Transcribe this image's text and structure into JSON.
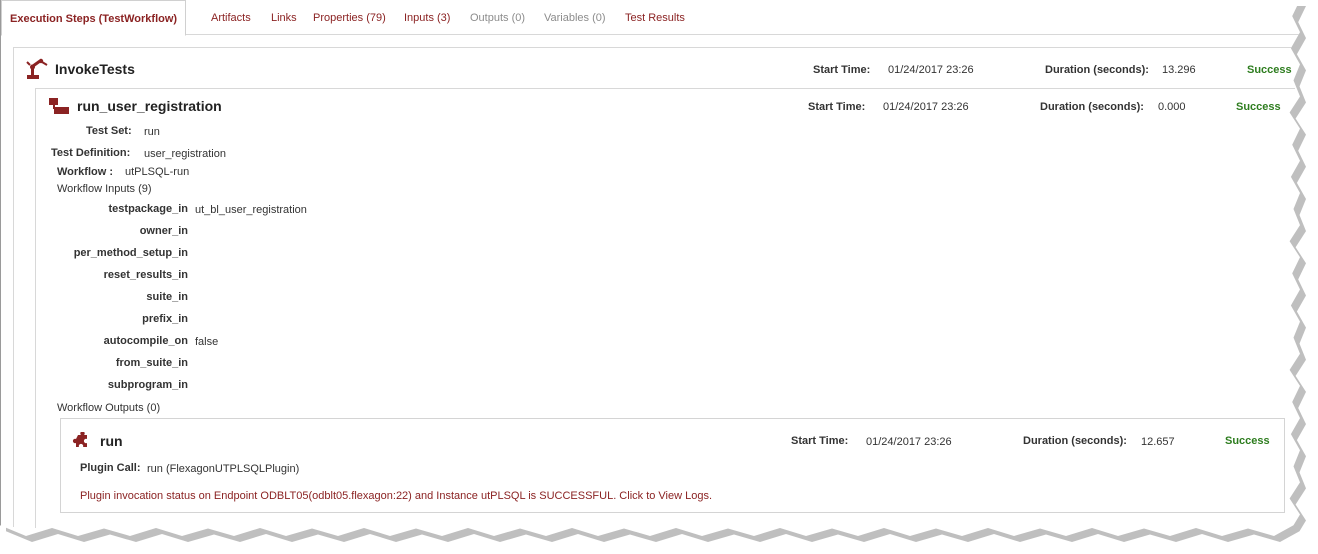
{
  "tabs": [
    {
      "label": "Execution Steps (TestWorkflow)",
      "state": "active"
    },
    {
      "label": "Artifacts",
      "state": "enabled"
    },
    {
      "label": "Links",
      "state": "enabled"
    },
    {
      "label": "Properties (79)",
      "state": "enabled"
    },
    {
      "label": "Inputs (3)",
      "state": "enabled"
    },
    {
      "label": "Outputs (0)",
      "state": "disabled"
    },
    {
      "label": "Variables (0)",
      "state": "disabled"
    },
    {
      "label": "Test Results",
      "state": "enabled"
    }
  ],
  "step": {
    "icon": "robot-arm-icon",
    "title": "InvokeTests",
    "start_label": "Start Time:",
    "start_value": "01/24/2017 23:26",
    "duration_label": "Duration (seconds):",
    "duration_value": "13.296",
    "status": "Success"
  },
  "test": {
    "icon": "test-definition-icon",
    "title": "run_user_registration",
    "start_label": "Start Time:",
    "start_value": "01/24/2017 23:26",
    "duration_label": "Duration (seconds):",
    "duration_value": "0.000",
    "status": "Success",
    "test_set_label": "Test Set:",
    "test_set_value": "run",
    "test_definition_label": "Test Definition:",
    "test_definition_value": "user_registration",
    "workflow_label": "Workflow :",
    "workflow_value": "utPLSQL-run",
    "workflow_inputs_label": "Workflow Inputs (9)",
    "inputs": [
      {
        "name": "testpackage_in",
        "value": "ut_bl_user_registration"
      },
      {
        "name": "owner_in",
        "value": ""
      },
      {
        "name": "per_method_setup_in",
        "value": ""
      },
      {
        "name": "reset_results_in",
        "value": ""
      },
      {
        "name": "suite_in",
        "value": ""
      },
      {
        "name": "prefix_in",
        "value": ""
      },
      {
        "name": "autocompile_on",
        "value": "false"
      },
      {
        "name": "from_suite_in",
        "value": ""
      },
      {
        "name": "subprogram_in",
        "value": ""
      }
    ],
    "workflow_outputs_label": "Workflow Outputs (0)"
  },
  "plugin": {
    "icon": "puzzle-piece-icon",
    "title": "run",
    "start_label": "Start Time:",
    "start_value": "01/24/2017 23:26",
    "duration_label": "Duration (seconds):",
    "duration_value": "12.657",
    "status": "Success",
    "call_label": "Plugin Call:",
    "call_value": "run (FlexagonUTPLSQLPlugin)",
    "log_message": "Plugin invocation status on Endpoint ODBLT05(odblt05.flexagon:22) and Instance utPLSQL is SUCCESSFUL. Click to View Logs."
  },
  "colors": {
    "accent": "#8b2323",
    "success": "#2e7d1f",
    "disabled": "#8c8c8c",
    "border": "#d8d8d8"
  }
}
